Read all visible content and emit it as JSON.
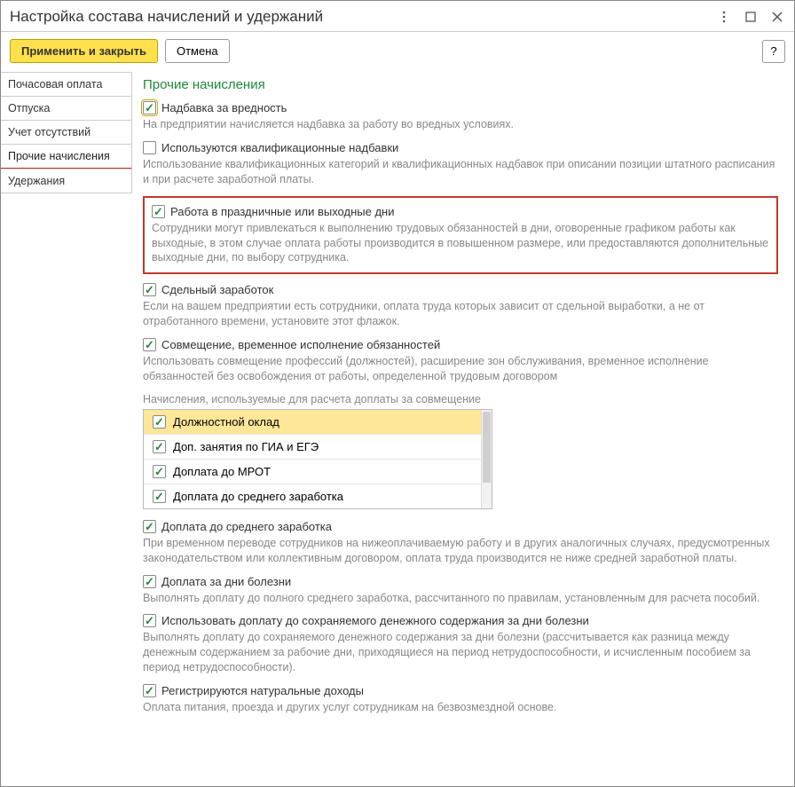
{
  "title": "Настройка состава начислений и удержаний",
  "toolbar": {
    "apply": "Применить и закрыть",
    "cancel": "Отмена",
    "help": "?"
  },
  "sidebar": {
    "items": [
      "Почасовая оплата",
      "Отпуска",
      "Учет отсутствий",
      "Прочие начисления",
      "Удержания"
    ],
    "activeIndex": 3
  },
  "section_title": "Прочие начисления",
  "opts": [
    {
      "label": "Надбавка за вредность",
      "checked": true,
      "framed": true,
      "desc": "На предприятии начисляется надбавка за работу во вредных условиях."
    },
    {
      "label": "Используются квалификационные надбавки",
      "checked": false,
      "desc": "Использование квалификационных категорий и квалификационных надбавок при описании позиции штатного расписания и при расчете заработной платы."
    },
    {
      "label": "Работа в праздничные или выходные дни",
      "checked": true,
      "desc": "Сотрудники могут привлекаться к выполнению трудовых обязанностей в дни, оговоренные графиком работы как выходные, в этом случае оплата работы производится в повышенном размере, или предоставляются дополнительные выходные дни, по выбору сотрудника.",
      "highlight": true
    },
    {
      "label": "Сдельный заработок",
      "checked": true,
      "desc": "Если на вашем предприятии есть сотрудники, оплата труда которых зависит от сдельной выработки, а не от отработанного времени, установите этот флажок."
    },
    {
      "label": "Совмещение, временное исполнение обязанностей",
      "checked": true,
      "desc": "Использовать совмещение профессий (должностей), расширение зон обслуживания, временное исполнение обязанностей без освобождения от работы, определенной трудовым договором"
    }
  ],
  "list_label": "Начисления, используемые для расчета доплаты за совмещение",
  "list_items": [
    {
      "label": "Должностной оклад",
      "checked": true,
      "selected": true
    },
    {
      "label": "Доп. занятия по ГИА и ЕГЭ",
      "checked": true,
      "selected": false
    },
    {
      "label": "Доплата до МРОТ",
      "checked": true,
      "selected": false
    },
    {
      "label": "Доплата до среднего заработка",
      "checked": true,
      "selected": false
    }
  ],
  "opts2": [
    {
      "label": "Доплата до среднего заработка",
      "checked": true,
      "desc": "При временном переводе сотрудников на нижеоплачиваемую работу и в других аналогичных случаях, предусмотренных законодательством или коллективным договором, оплата труда производится не ниже средней заработной платы."
    },
    {
      "label": "Доплата за дни болезни",
      "checked": true,
      "desc": "Выполнять доплату до полного среднего заработка, рассчитанного по правилам, установленным для расчета пособий."
    },
    {
      "label": "Использовать доплату до сохраняемого денежного содержания за дни болезни",
      "checked": true,
      "desc": "Выполнять доплату до сохраняемого денежного содержания за дни болезни (рассчитывается как разница между денежным содержанием за рабочие дни, приходящиеся на период нетрудоспособности, и исчисленным пособием за период нетрудоспособности)."
    },
    {
      "label": "Регистрируются натуральные доходы",
      "checked": true,
      "desc": "Оплата питания, проезда и других услуг сотрудникам на безвозмездной основе."
    }
  ]
}
